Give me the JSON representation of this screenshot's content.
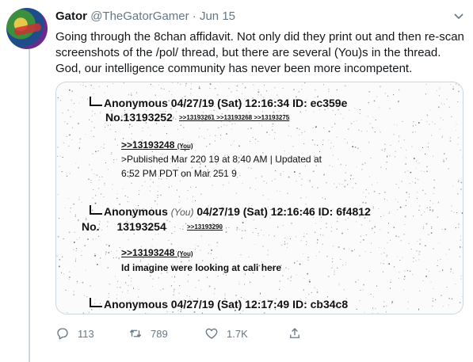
{
  "tweet": {
    "author_name": "Gator",
    "handle": "@TheGatorGamer",
    "separator": "·",
    "date": "Jun 15",
    "text": "Going through the 8chan affidavit. Not only did they print out and then re-scan screenshots of the /pol/ thread, but there are several (You)s in the thread. God, our intelligence community has never been more incompetent."
  },
  "media": {
    "post1": {
      "header": "Anonymous 04/27/19 (Sat) 12:16:34 ID: ec359e",
      "number": "No.13193252",
      "replies": ">>13193261 >>13193268 >>13193275",
      "quote": ">>13193248",
      "quote_you": "(You)",
      "published_line1": ">Published Mar 220 19 at 8:40 AM | Updated at",
      "published_line2": "6:52 PM PDT on Mar 251 9"
    },
    "post2": {
      "name": "Anonymous",
      "you_tag": "(You)",
      "header_rest": "04/27/19 (Sat) 12:16:46 ID: 6f4812",
      "no_label": "No.",
      "number": "13193254",
      "replies": ">>13193290",
      "quote": ">>13193248",
      "quote_you": "(You)",
      "body": "Id imagine were looking at cali here"
    },
    "post3": {
      "header": "Anonymous 04/27/19 (Sat) 12:17:49 ID: cb34c8"
    }
  },
  "actions": {
    "reply_count": "113",
    "retweet_count": "789",
    "like_count": "1.7K"
  },
  "colors": {
    "secondary_text": "#657786",
    "border": "#ccd6dd"
  }
}
